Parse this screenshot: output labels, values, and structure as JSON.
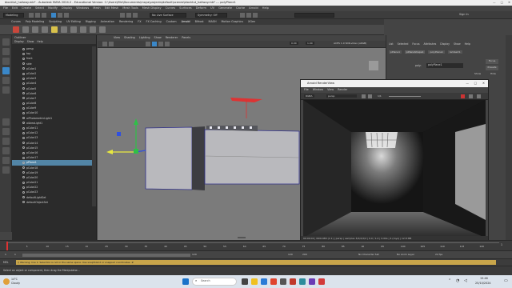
{
  "window": {
    "title": "blocktut_hallway.mb* - Autodesk MAYA 2024.2 - Educational Version: C:\\Users\\Elle\\Documents\\maya\\projects\\default\\scenes\\blocktut_hallway.mb* --- polyPlane1",
    "minimize": "—",
    "maximize": "□",
    "close": "✕"
  },
  "menu": [
    "File",
    "Edit",
    "Create",
    "Select",
    "Modify",
    "Display",
    "Windows",
    "Mesh",
    "Edit Mesh",
    "Mesh Tools",
    "Mesh Display",
    "Curves",
    "Surfaces",
    "Deform",
    "UV",
    "Generate",
    "Cache",
    "Arnold",
    "Help"
  ],
  "status": {
    "workspace": "Modeling",
    "selector": "No Live Surface",
    "symmetry": "Symmetry: Off",
    "signin": "Sign In"
  },
  "shelf_tabs": [
    "Curves",
    "Poly Modeling",
    "Sculpting",
    "UV Editing",
    "Rigging",
    "Animation",
    "Rendering",
    "FX",
    "FX Caching",
    "Custom",
    "Arnold",
    "Bifrost",
    "MASH",
    "Motion Graphics",
    "XGen"
  ],
  "outliner": {
    "title": "Outliner",
    "menu": [
      "Display",
      "Show",
      "Help"
    ],
    "search": "Search...",
    "items": [
      "persp",
      "top",
      "front",
      "side",
      "pCube1",
      "pCube2",
      "pCube3",
      "pCube4",
      "pCube5",
      "pCube6",
      "pCube7",
      "pCube8",
      "pCube9",
      "pCube10",
      "aiPhotometricLight1",
      "aiAreaLight1",
      "pCube11",
      "pCube12",
      "pCube13",
      "pCube14",
      "pCube15",
      "pCube16",
      "pCube17",
      "pPlane1",
      "pCube18",
      "pCube19",
      "pCube20",
      "pCube21",
      "pCube22",
      "pCube23",
      "defaultLightSet",
      "defaultObjectSet"
    ],
    "selected_index": 23
  },
  "viewport": {
    "menu": [
      "View",
      "Shading",
      "Lighting",
      "Show",
      "Renderer",
      "Panels"
    ],
    "camera": "persp",
    "values": [
      "0.00",
      "1.00"
    ],
    "colorspace": "ACES 1.0 SDR-video (sRGB)"
  },
  "render_view": {
    "title": "Arnold RenderView",
    "menu": [
      "File",
      "Window",
      "View",
      "Render"
    ],
    "camera": "persp",
    "aov": "RGBA",
    "fraction": "1/1",
    "status": "00:00:02 | 640x480 (1:1) | persp | samples 3/2/2/2/2 | 0.0 / 1.0 | 0.00s | 4 (rays) | 12.8 MB"
  },
  "right_panel": {
    "tabs": [
      "List",
      "Selected",
      "Focus",
      "Attributes",
      "Display",
      "Show",
      "Help"
    ],
    "node_tabs": [
      "pPlane1",
      "pPlaneShape1",
      "polyPlane1",
      "lambert1"
    ],
    "node_label": "poly:",
    "node_value": "polyPlane1",
    "focus": "Focus",
    "presets": "Presets",
    "show": "Show",
    "hide": "Hide"
  },
  "timeline": {
    "ticks": [
      "5",
      "10",
      "15",
      "20",
      "25",
      "30",
      "35",
      "40",
      "45",
      "50",
      "55",
      "60",
      "65",
      "70",
      "75",
      "80",
      "85",
      "90",
      "95",
      "100",
      "105",
      "110",
      "115",
      "120"
    ],
    "current": "1"
  },
  "range": {
    "start": "1",
    "inner_start": "1",
    "mid": "120",
    "end_a": "120",
    "end_b": "200",
    "char_set": "No Character Set",
    "anim_layer": "No Anim Layer",
    "fps": "24 fps"
  },
  "command": {
    "lang": "MEL",
    "message": "// Warning: line 1: Selection is not in the same space. Use snapToGrid or snapped coordinates. #"
  },
  "help": "Select an object or component, then drag the Manipulator...",
  "taskbar": {
    "weather_temp": "14°C",
    "weather_desc": "Cloudy",
    "search": "Search",
    "time": "15:46",
    "date": "25/10/2024"
  }
}
